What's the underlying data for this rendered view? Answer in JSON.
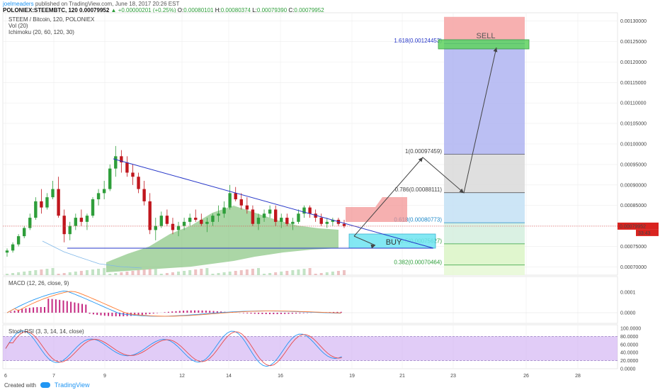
{
  "header": {
    "author": "joelmeaders",
    "published": "published on TradingView.com, June 18, 2017 20:26 EST",
    "symbol": "POLONIEX:STEEMBTC, 120",
    "last": "0.00079952",
    "change": "+0.00000201 (+0.25%)",
    "o_label": "O:",
    "o": "0.00080101",
    "h_label": "H:",
    "h": "0.00080374",
    "l_label": "L:",
    "l": "0.00079390",
    "c_label": "C:",
    "c": "0.00079952"
  },
  "indicators": {
    "title": "STEEM / Bitcoin, 120, POLONIEX",
    "vol": "Vol (20)",
    "ichimoku": "Ichimoku (20, 60, 120, 30)",
    "macd": "MACD (12, 26, close, 9)",
    "stoch": "Stoch RSI (3, 3, 14, 14, close)"
  },
  "footer": {
    "created": "Created with",
    "brand": "TradingView"
  },
  "annotations": {
    "buy": "BUY",
    "sell": "SELL"
  },
  "colors": {
    "bull": "#2e9e3a",
    "bear": "#c0161d",
    "cloud": "#66b45c",
    "trend": "#2636c8",
    "macd": "#2196f3",
    "signal": "#ff7a2f",
    "stoch_k": "#2196f3",
    "stoch_d": "#e84b4b",
    "stoch_band": "#c9a2f0"
  },
  "chart_data": [
    {
      "type": "candlestick",
      "title": "STEEM / Bitcoin, 120, POLONIEX",
      "x_ticks": [
        "6",
        "7",
        "9",
        "12",
        "14",
        "16",
        "19",
        "21",
        "23",
        "26",
        "28"
      ],
      "y_ticks": [
        "0.00130000",
        "0.00125000",
        "0.00120000",
        "0.00115000",
        "0.00110000",
        "0.00105000",
        "0.00100000",
        "0.00095000",
        "0.00090000",
        "0.00085000",
        "0.00080000",
        "0.00075000",
        "0.00070000"
      ],
      "ylim": [
        0.00068,
        0.00132
      ],
      "last_price_label": "0.00079952",
      "countdown_label": "33:43",
      "fib_levels": [
        {
          "label": "1.618(0.00124453)",
          "value": 0.00124453
        },
        {
          "label": "1(0.00097459)",
          "value": 0.00097459
        },
        {
          "label": "0.786(0.00088111)",
          "value": 0.00088111
        },
        {
          "label": "0.618(0.00080773)",
          "value": 0.00080773
        },
        {
          "label": "0.5(0.00075627)",
          "value": 0.00075627
        },
        {
          "label": "0.382(0.00070464)",
          "value": 0.00070464
        }
      ],
      "candles_approx": [
        [
          0.000735,
          0.000745,
          0.000725,
          0.00074
        ],
        [
          0.00074,
          0.00076,
          0.000735,
          0.000755
        ],
        [
          0.000755,
          0.00078,
          0.00075,
          0.000775
        ],
        [
          0.000775,
          0.0008,
          0.00077,
          0.000795
        ],
        [
          0.000795,
          0.00083,
          0.00079,
          0.00082
        ],
        [
          0.00082,
          0.00087,
          0.000815,
          0.00086
        ],
        [
          0.00086,
          0.00089,
          0.00083,
          0.000845
        ],
        [
          0.000845,
          0.00088,
          0.00084,
          0.00087
        ],
        [
          0.00087,
          0.00091,
          0.000865,
          0.00089
        ],
        [
          0.00089,
          0.00092,
          0.00082,
          0.000825
        ],
        [
          0.000825,
          0.00084,
          0.00076,
          0.00078
        ],
        [
          0.00078,
          0.00081,
          0.000765,
          0.0008
        ],
        [
          0.0008,
          0.00083,
          0.00079,
          0.00082
        ],
        [
          0.00082,
          0.00084,
          0.0008,
          0.00081
        ],
        [
          0.00081,
          0.00083,
          0.00079,
          0.000825
        ],
        [
          0.000825,
          0.00087,
          0.00082,
          0.000865
        ],
        [
          0.000865,
          0.00089,
          0.00085,
          0.00088
        ],
        [
          0.00088,
          0.00091,
          0.000865,
          0.00089
        ],
        [
          0.00089,
          0.00095,
          0.000885,
          0.00094
        ],
        [
          0.00094,
          0.000995,
          0.00092,
          0.00097
        ],
        [
          0.00097,
          0.000985,
          0.00093,
          0.000955
        ],
        [
          0.000955,
          0.00097,
          0.00092,
          0.00093
        ],
        [
          0.00093,
          0.00095,
          0.0009,
          0.00092
        ],
        [
          0.00092,
          0.00093,
          0.00088,
          0.00089
        ],
        [
          0.00089,
          0.00091,
          0.00085,
          0.00086
        ],
        [
          0.00086,
          0.00088,
          0.00078,
          0.00079
        ],
        [
          0.00079,
          0.00082,
          0.000765,
          0.0008
        ],
        [
          0.0008,
          0.000835,
          0.000795,
          0.000825
        ],
        [
          0.000825,
          0.00084,
          0.0008,
          0.000805
        ],
        [
          0.000805,
          0.00082,
          0.00078,
          0.00079
        ],
        [
          0.00079,
          0.00081,
          0.000775,
          0.0008
        ],
        [
          0.0008,
          0.00082,
          0.00079,
          0.00081
        ],
        [
          0.00081,
          0.00083,
          0.0008,
          0.00082
        ],
        [
          0.00082,
          0.00084,
          0.00081,
          0.000815
        ],
        [
          0.000815,
          0.00083,
          0.0008,
          0.000805
        ],
        [
          0.000805,
          0.00082,
          0.000785,
          0.00081
        ],
        [
          0.00081,
          0.00083,
          0.0008,
          0.000825
        ],
        [
          0.000825,
          0.00085,
          0.00081,
          0.00083
        ],
        [
          0.00083,
          0.00086,
          0.00082,
          0.000845
        ],
        [
          0.000845,
          0.0009,
          0.00084,
          0.00088
        ],
        [
          0.00088,
          0.000895,
          0.00086,
          0.000865
        ],
        [
          0.000865,
          0.00088,
          0.00084,
          0.00085
        ],
        [
          0.00085,
          0.00087,
          0.00083,
          0.00084
        ],
        [
          0.00084,
          0.00085,
          0.0008,
          0.000805
        ],
        [
          0.000805,
          0.00083,
          0.00079,
          0.00082
        ],
        [
          0.00082,
          0.00084,
          0.00081,
          0.00083
        ],
        [
          0.00083,
          0.00085,
          0.00082,
          0.00084
        ],
        [
          0.00084,
          0.00085,
          0.0008,
          0.00081
        ],
        [
          0.00081,
          0.00083,
          0.000795,
          0.00082
        ],
        [
          0.00082,
          0.00083,
          0.0008,
          0.000805
        ],
        [
          0.000805,
          0.00082,
          0.00079,
          0.00081
        ],
        [
          0.00081,
          0.00084,
          0.000805,
          0.00083
        ],
        [
          0.00083,
          0.00085,
          0.00082,
          0.000845
        ],
        [
          0.000845,
          0.00085,
          0.00082,
          0.00083
        ],
        [
          0.00083,
          0.00084,
          0.00081,
          0.00082
        ],
        [
          0.00082,
          0.00083,
          0.0008,
          0.000805
        ],
        [
          0.000805,
          0.00082,
          0.000795,
          0.00081
        ],
        [
          0.00081,
          0.00082,
          0.0008,
          0.000815
        ],
        [
          0.000815,
          0.00082,
          0.0008,
          0.000805
        ],
        [
          0.000805,
          0.000815,
          0.000795,
          0.0008
        ]
      ]
    },
    {
      "type": "line",
      "title": "MACD (12, 26, close, 9)",
      "y_ticks": [
        "0.0001",
        "0.0000"
      ],
      "series": [
        {
          "name": "MACD"
        },
        {
          "name": "Signal"
        }
      ]
    },
    {
      "type": "line",
      "title": "Stoch RSI (3, 3, 14, 14, close)",
      "y_ticks": [
        "100.0000",
        "80.0000",
        "60.0000",
        "40.0000",
        "20.0000",
        "0.0000"
      ],
      "ylim": [
        0,
        100
      ]
    }
  ]
}
